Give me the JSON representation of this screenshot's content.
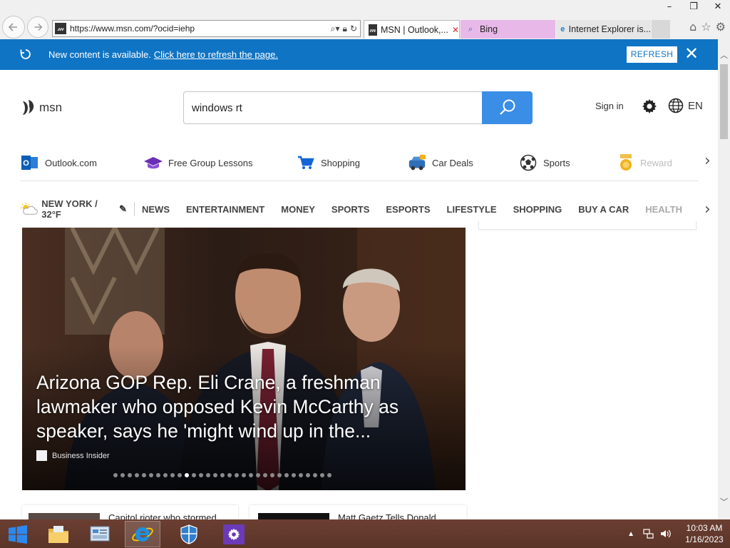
{
  "browser": {
    "url": "https://www.msn.com/?ocid=iehp",
    "tabs": [
      {
        "label": "MSN | Outlook,...",
        "active": true
      },
      {
        "label": "Bing",
        "active": false
      },
      {
        "label": "Internet Explorer is...",
        "active": false
      }
    ],
    "window_controls": {
      "minimize": "–",
      "restore": "❐",
      "close": "✕"
    }
  },
  "notification": {
    "message": "New content is available.",
    "link": "Click here to refresh the page.",
    "refresh_label": "REFRESH"
  },
  "header": {
    "logo_text": "msn",
    "search_value": "windows rt",
    "sign_in": "Sign in",
    "language": "EN"
  },
  "quick_links": [
    {
      "label": "Outlook.com",
      "icon": "outlook-icon"
    },
    {
      "label": "Free Group Lessons",
      "icon": "graduation-cap-icon"
    },
    {
      "label": "Shopping",
      "icon": "shopping-cart-icon"
    },
    {
      "label": "Car Deals",
      "icon": "car-icon"
    },
    {
      "label": "Sports",
      "icon": "soccer-ball-icon"
    },
    {
      "label": "Rewards",
      "icon": "medal-icon"
    }
  ],
  "weather": {
    "label": "NEW YORK / 32°F",
    "icon": "partly-sunny-icon"
  },
  "categories": [
    "NEWS",
    "ENTERTAINMENT",
    "MONEY",
    "SPORTS",
    "ESPORTS",
    "LIFESTYLE",
    "SHOPPING",
    "BUY A CAR",
    "HEALTH"
  ],
  "hero": {
    "headline": "Arizona GOP Rep. Eli Crane, a freshman lawmaker who opposed Kevin McCarthy as speaker, says he 'might wind up in the...",
    "source": "Business Insider",
    "dot_count": 31,
    "active_dot": 10
  },
  "cards": [
    {
      "title": "Capitol rioter who stormed"
    },
    {
      "title": "Matt Gaetz Tells Donald"
    }
  ],
  "taskbar": {
    "time": "10:03 AM",
    "date": "1/16/2023"
  }
}
